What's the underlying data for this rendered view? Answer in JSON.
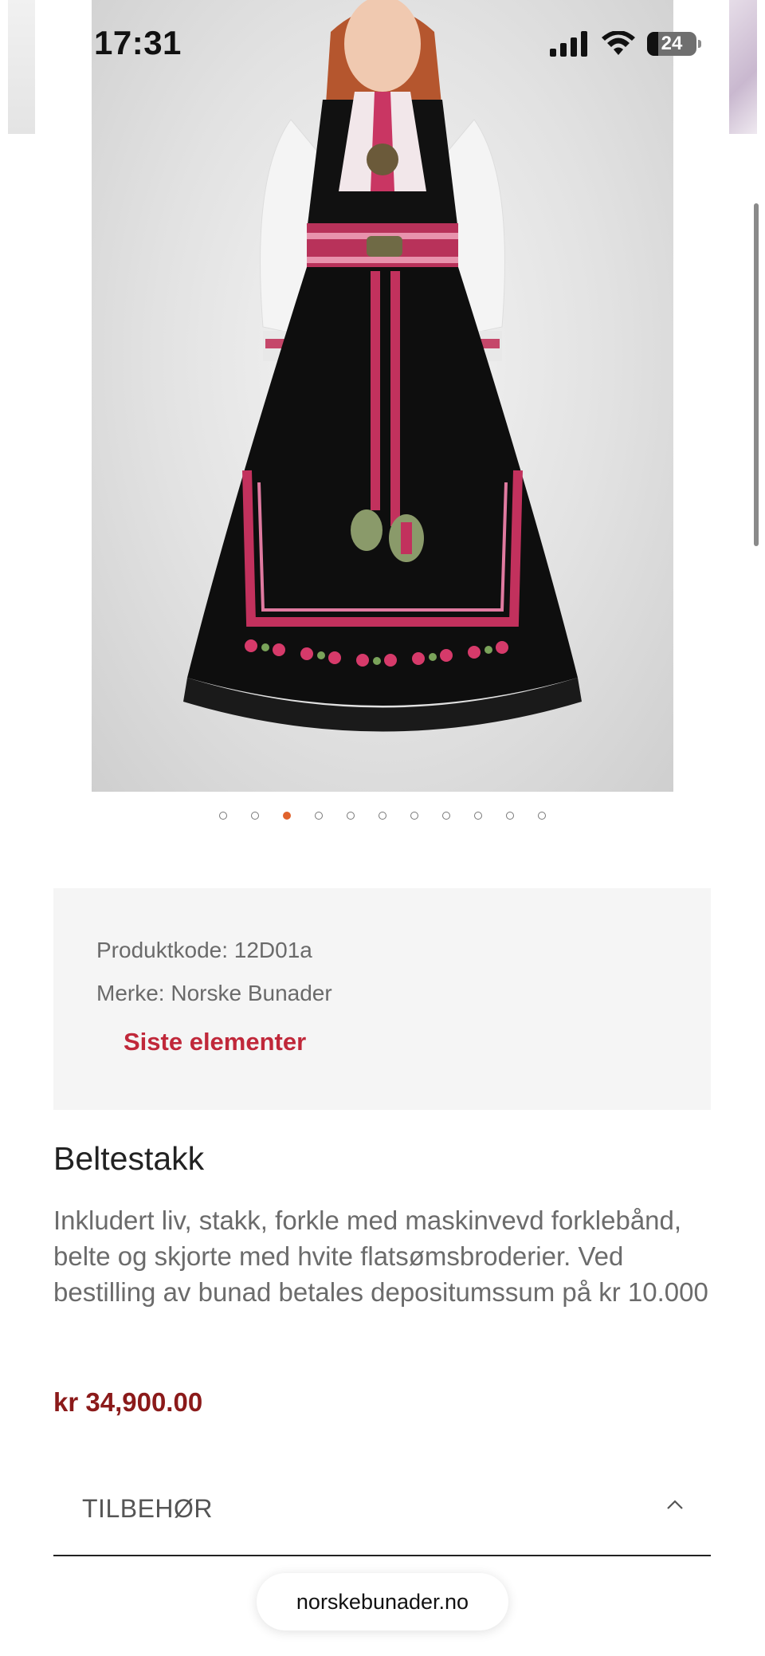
{
  "status_bar": {
    "time": "17:31",
    "battery": "24",
    "icons": [
      "signal-icon",
      "wifi-icon",
      "battery-icon"
    ]
  },
  "carousel": {
    "slide_count": 11,
    "active_index": 2,
    "image_alt": "bunad-photo"
  },
  "product_info": {
    "code": "Produktkode: 12D01a",
    "brand": "Merke: Norske Bunader",
    "stock_status": "Siste elementer"
  },
  "product": {
    "title": "Beltestakk",
    "description": "Inkludert liv, stakk, forkle med maskinvevd forklebånd, belte og skjorte med hvite flatsømsbroderier. Ved bestilling av bunad betales depositumssum på kr 10.000",
    "price": "kr 34,900.00"
  },
  "accordion": {
    "label": "TILBEHØR",
    "expanded": true
  },
  "browser": {
    "url": "norskebunader.no"
  },
  "colors": {
    "accent": "#e0622c",
    "stock_red": "#c0283a",
    "price_red": "#8b1a1a",
    "panel_bg": "#f5f5f5"
  }
}
